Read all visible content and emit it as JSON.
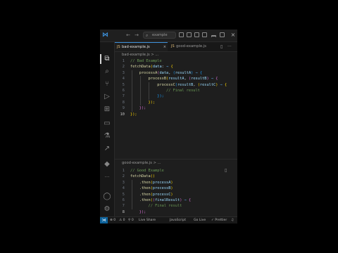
{
  "titlebar": {
    "search_text": "example",
    "back_glyph": "←",
    "forward_glyph": "→",
    "close_glyph": "×",
    "logo_glyph": "⋈"
  },
  "tabs": [
    {
      "label": "bad-example.js",
      "active": true,
      "close_glyph": "×"
    },
    {
      "label": "good-example.js",
      "active": false,
      "close_glyph": ""
    }
  ],
  "tab_actions": {
    "split": "▯",
    "more": "···"
  },
  "panes": [
    {
      "breadcrumb": "bad-example.js > ...",
      "lines": [
        {
          "n": "1",
          "segs": [
            [
              "// Bad Example",
              "c-comment"
            ]
          ]
        },
        {
          "n": "2",
          "segs": [
            [
              "fetchData",
              "c-fn"
            ],
            [
              "(",
              "c-brace1"
            ],
            [
              "data",
              "c-param"
            ],
            [
              ": ",
              "c-punc"
            ],
            [
              "⇒",
              "c-op"
            ],
            [
              " {",
              "c-brace1"
            ]
          ]
        },
        {
          "n": "3",
          "segs": [
            [
              "    processA",
              "c-fn"
            ],
            [
              "(",
              "c-brace2"
            ],
            [
              "data",
              "c-param"
            ],
            [
              ", ",
              "c-punc"
            ],
            [
              "(",
              "c-brace3"
            ],
            [
              "resultA",
              "c-param"
            ],
            [
              ") ",
              "c-brace3"
            ],
            [
              "⇒",
              "c-op"
            ],
            [
              " {",
              "c-brace3"
            ]
          ]
        },
        {
          "n": "4",
          "segs": [
            [
              "        processB",
              "c-fn"
            ],
            [
              "(",
              "c-brace1"
            ],
            [
              "resultA",
              "c-param"
            ],
            [
              ", ",
              "c-punc"
            ],
            [
              "(",
              "c-brace2"
            ],
            [
              "resultB",
              "c-param"
            ],
            [
              ") ",
              "c-brace2"
            ],
            [
              "⇒",
              "c-op"
            ],
            [
              " {",
              "c-brace2"
            ]
          ]
        },
        {
          "n": "5",
          "segs": [
            [
              "            processC",
              "c-fn"
            ],
            [
              "(",
              "c-brace3"
            ],
            [
              "resultB",
              "c-param"
            ],
            [
              ", ",
              "c-punc"
            ],
            [
              "(",
              "c-brace1"
            ],
            [
              "resultC",
              "c-param"
            ],
            [
              ") ",
              "c-brace1"
            ],
            [
              "⇒",
              "c-op"
            ],
            [
              " {",
              "c-brace1"
            ]
          ]
        },
        {
          "n": "6",
          "segs": [
            [
              "                // Final result",
              "c-comment"
            ]
          ]
        },
        {
          "n": "7",
          "segs": [
            [
              "            });",
              "c-brace3"
            ]
          ]
        },
        {
          "n": "8",
          "segs": [
            [
              "        });",
              "c-brace1"
            ]
          ]
        },
        {
          "n": "9",
          "segs": [
            [
              "    });",
              "c-brace2"
            ]
          ]
        },
        {
          "n": "10",
          "segs": [
            [
              "});",
              "c-brace1"
            ]
          ],
          "current": true
        }
      ]
    },
    {
      "breadcrumb": "good-example.js > ...",
      "lines": [
        {
          "n": "1",
          "segs": [
            [
              "// Good Example",
              "c-comment"
            ]
          ]
        },
        {
          "n": "2",
          "segs": [
            [
              "fetchData",
              "c-fn"
            ],
            [
              "()",
              "c-brace1"
            ]
          ]
        },
        {
          "n": "3",
          "segs": [
            [
              "    .then",
              "c-fn"
            ],
            [
              "(",
              "c-brace1"
            ],
            [
              "processA",
              "c-param"
            ],
            [
              ")",
              "c-brace1"
            ]
          ]
        },
        {
          "n": "4",
          "segs": [
            [
              "    .then",
              "c-fn"
            ],
            [
              "(",
              "c-brace1"
            ],
            [
              "processB",
              "c-param"
            ],
            [
              ")",
              "c-brace1"
            ]
          ]
        },
        {
          "n": "5",
          "segs": [
            [
              "    .then",
              "c-fn"
            ],
            [
              "(",
              "c-brace1"
            ],
            [
              "processC",
              "c-param"
            ],
            [
              ")",
              "c-brace1"
            ]
          ]
        },
        {
          "n": "6",
          "segs": [
            [
              "    .then",
              "c-fn"
            ],
            [
              "(",
              "c-brace1"
            ],
            [
              "(",
              "c-brace2"
            ],
            [
              "finalResult",
              "c-param"
            ],
            [
              ") ",
              "c-brace2"
            ],
            [
              "⇒",
              "c-op"
            ],
            [
              " {",
              "c-brace2"
            ]
          ]
        },
        {
          "n": "7",
          "segs": [
            [
              "        // Final result",
              "c-comment"
            ]
          ]
        },
        {
          "n": "8",
          "segs": [
            [
              "    });",
              "c-brace2"
            ]
          ],
          "current": true
        }
      ]
    }
  ],
  "activity_icons": [
    {
      "name": "explorer-icon",
      "glyph": "⧉"
    },
    {
      "name": "search-icon",
      "glyph": "⌕"
    },
    {
      "name": "source-control-icon",
      "glyph": "⑂"
    },
    {
      "name": "run-debug-icon",
      "glyph": "▷"
    },
    {
      "name": "extensions-icon",
      "glyph": "⊞"
    },
    {
      "name": "remote-explorer-icon",
      "glyph": "▭"
    },
    {
      "name": "testing-icon",
      "glyph": "⚗"
    },
    {
      "name": "live-share-icon",
      "glyph": "↗"
    },
    {
      "name": "docker-icon",
      "glyph": "◆"
    },
    {
      "name": "more-icon",
      "glyph": "···"
    },
    {
      "name": "account-icon",
      "glyph": "◯"
    },
    {
      "name": "settings-gear-icon",
      "glyph": "⚙"
    }
  ],
  "statusbar": {
    "remote_glyph": "⋊",
    "errors": "⊗ 0",
    "warnings": "⚠ 0",
    "ports": "⚲ 0",
    "live_share": "Live Share",
    "language": "JavaScript",
    "go_live": "Go Live",
    "prettier": "✓ Prettier",
    "bell": "♫"
  },
  "colors": {
    "accent": "#3c8fd8",
    "editor_bg": "#1e1e1e",
    "comment": "#6a9955",
    "function": "#dcdcaa",
    "param": "#9cdcfe",
    "keyword": "#569cd6"
  }
}
